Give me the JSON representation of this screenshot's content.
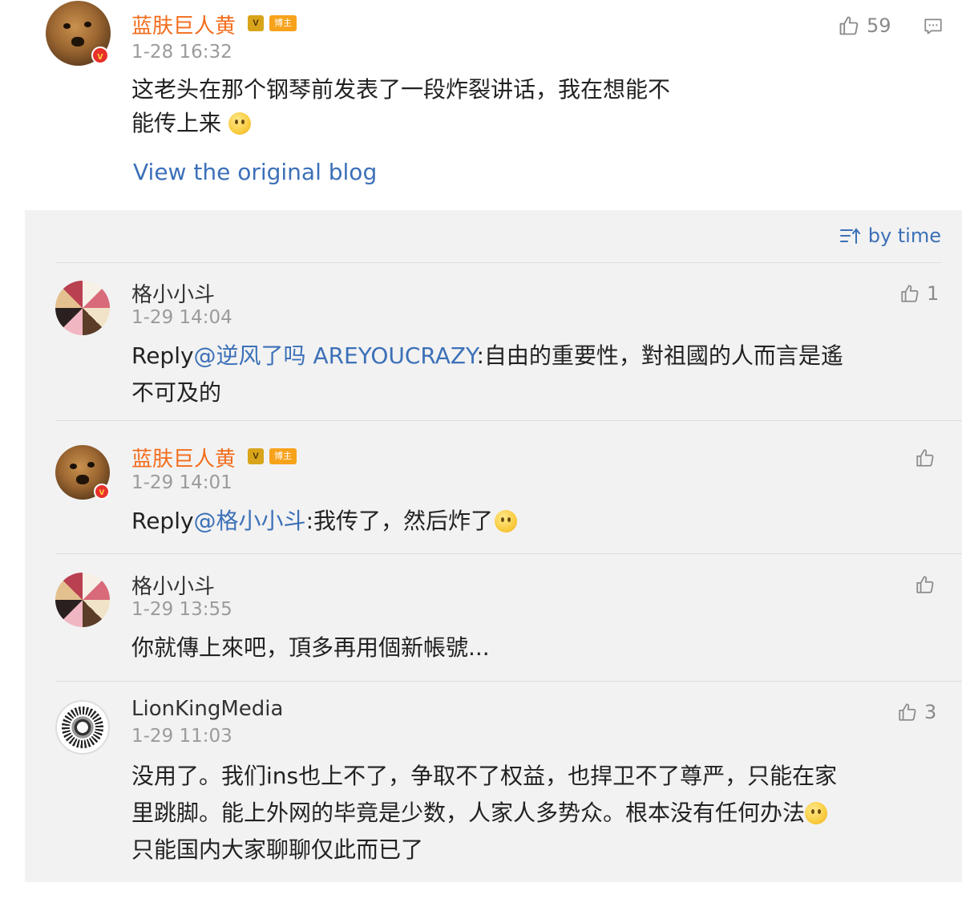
{
  "post": {
    "author": "蓝肤巨人黄",
    "badge": "博主",
    "time": "1-28 16:32",
    "likes": "59",
    "text": "这老头在那个钢琴前发表了一段炸裂讲话，我在想能不能传上来",
    "text_line1": "这老头在那个钢琴前发表了一段炸裂讲话，我在想能不",
    "text_line2": "能传上来",
    "view_original": "View the original blog"
  },
  "sort_label": "by time",
  "comments": [
    {
      "author": "格小小斗",
      "time": "1-29 14:04",
      "likes": "1",
      "reply_prefix": "Reply",
      "mention": "@逆风了吗 AREYOUCRAZY",
      "text_line1": ":自由的重要性，對祖國的人而言是遙",
      "text_line2": "不可及的"
    },
    {
      "author": "蓝肤巨人黄",
      "badge": "博主",
      "time": "1-29 14:01",
      "likes": "",
      "reply_prefix": "Reply",
      "mention": "@格小小斗",
      "text_line1": ":我传了，然后炸了"
    },
    {
      "author": "格小小斗",
      "time": "1-29 13:55",
      "likes": "",
      "text_line1": "你就傳上來吧，頂多再用個新帳號..."
    },
    {
      "author": "LionKingMedia",
      "time": "1-29 11:03",
      "likes": "3",
      "text_line1": "没用了。我们ins也上不了，争取不了权益，也捍卫不了尊严，只能在家",
      "text_line2": "里跳脚。能上外网的毕竟是少数，人家人多势众。根本没有任何办法",
      "text_line3": "只能国内大家聊聊仅此而已了"
    }
  ],
  "icons": {
    "like": "thumbs-up-icon",
    "comment": "comment-icon",
    "sort": "sort-icon",
    "verified": "verified-v-icon",
    "emoji": "emoji-icon"
  },
  "colors": {
    "author_orange": "#f36c1b",
    "link_blue": "#3c70b8",
    "time_gray": "#9b9b9b",
    "comment_bg": "#f2f2f2"
  }
}
